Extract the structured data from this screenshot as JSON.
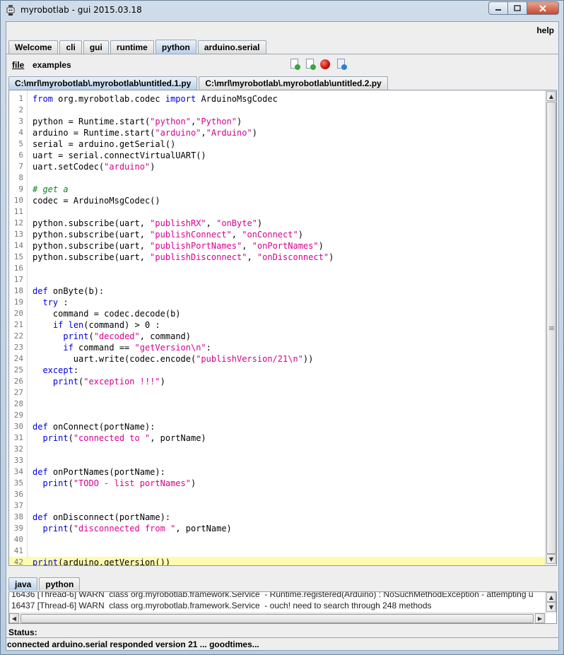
{
  "window": {
    "title": "myrobotlab - gui 2015.03.18"
  },
  "menu": {
    "help": "help",
    "file": "file",
    "examples": "examples"
  },
  "main_tabs": [
    {
      "label": "Welcome",
      "active": false
    },
    {
      "label": "cli",
      "active": false
    },
    {
      "label": "gui",
      "active": false
    },
    {
      "label": "runtime",
      "active": false
    },
    {
      "label": "python",
      "active": true
    },
    {
      "label": "arduino.serial",
      "active": false
    }
  ],
  "toolbar_icons": [
    "new-script-icon",
    "open-script-icon",
    "stop-icon",
    "execute-icon"
  ],
  "file_tabs": [
    {
      "label": "C:\\mrl\\myrobotlab\\.myrobotlab\\untitled.1.py",
      "active": true
    },
    {
      "label": "C:\\mrl\\myrobotlab\\.myrobotlab\\untitled.2.py",
      "active": false
    }
  ],
  "code_lines": [
    "from org.myrobotlab.codec import ArduinoMsgCodec",
    "",
    "python = Runtime.start(\"python\",\"Python\")",
    "arduino = Runtime.start(\"arduino\",\"Arduino\")",
    "serial = arduino.getSerial()",
    "uart = serial.connectVirtualUART()",
    "uart.setCodec(\"arduino\")",
    "",
    "# get a",
    "codec = ArduinoMsgCodec()",
    "",
    "python.subscribe(uart, \"publishRX\", \"onByte\")",
    "python.subscribe(uart, \"publishConnect\", \"onConnect\")",
    "python.subscribe(uart, \"publishPortNames\", \"onPortNames\")",
    "python.subscribe(uart, \"publishDisconnect\", \"onDisconnect\")",
    "",
    "",
    "def onByte(b):",
    "  try :",
    "    command = codec.decode(b)",
    "    if len(command) > 0 :",
    "      print(\"decoded\", command)",
    "      if command == \"getVersion\\n\":",
    "        uart.write(codec.encode(\"publishVersion/21\\n\"))",
    "  except:",
    "    print(\"exception !!!\")",
    "",
    "",
    "",
    "def onConnect(portName):",
    "  print(\"connected to \", portName)",
    "",
    "",
    "def onPortNames(portName):",
    "  print(\"TODO - list portNames\")",
    "",
    "",
    "def onDisconnect(portName):",
    "  print(\"disconnected from \", portName)",
    "",
    "",
    "print(arduino.getVersion())"
  ],
  "current_line": 42,
  "bottom_tabs": [
    {
      "label": "java",
      "active": true
    },
    {
      "label": "python",
      "active": false
    }
  ],
  "log_lines": [
    "16436 [Thread-6] WARN  class org.myrobotlab.framework.Service  - Runtime.registered(Arduino) : NoSuchMethodException - attempting u",
    "16437 [Thread-6] WARN  class org.myrobotlab.framework.Service  - ouch! need to search through 248 methods"
  ],
  "status": {
    "label": "Status:",
    "message": "connected arduino.serial responded version 21 ... goodtimes..."
  }
}
